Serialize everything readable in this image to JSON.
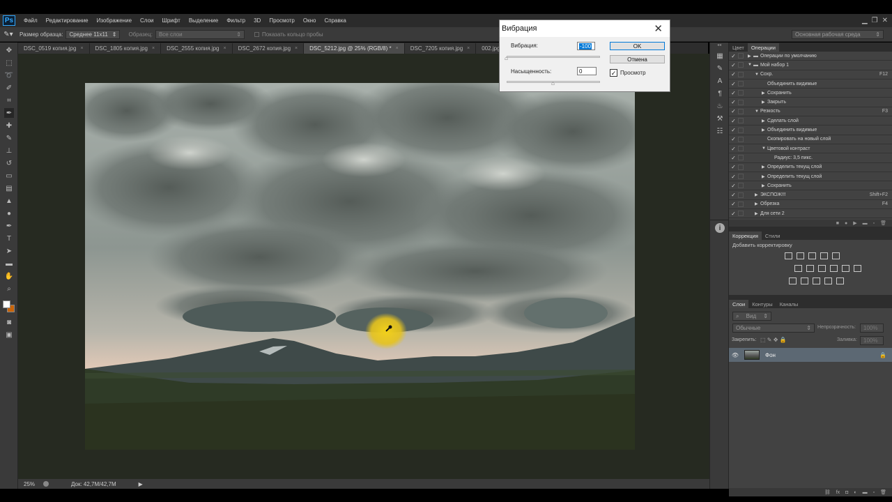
{
  "menu": [
    "Файл",
    "Редактирование",
    "Изображение",
    "Слои",
    "Шрифт",
    "Выделение",
    "Фильтр",
    "3D",
    "Просмотр",
    "Окно",
    "Справка"
  ],
  "app_logo": "Ps",
  "options": {
    "sample_size_label": "Размер образца:",
    "sample_size_value": "Среднее 11x11",
    "sample_label": "Образец:",
    "sample_value": "Все слои",
    "show_ring": "Показать кольцо пробы",
    "workspace": "Основная рабочая среда"
  },
  "tabs": [
    "DSC_0519 копия.jpg",
    "DSC_1805 копия.jpg",
    "DSC_2555 копия.jpg",
    "DSC_2672 копия.jpg",
    "DSC_5212.jpg @ 25% (RGB/8) *",
    "DSC_7205 копия.jpg",
    "002.jpg"
  ],
  "status": {
    "zoom": "25%",
    "doc": "Док: 42,7M/42,7M"
  },
  "dialog": {
    "title": "Вибрация",
    "vibrance_label": "Вибрация:",
    "vibrance_value": "-100",
    "saturation_label": "Насыщенность:",
    "saturation_value": "0",
    "ok": "OK",
    "cancel": "Отмена",
    "preview": "Просмотр",
    "vibrance_level": 0.0,
    "saturation_level": 0.5
  },
  "actions_panel": {
    "tabs": [
      "Цвет",
      "Операции"
    ],
    "rows": [
      {
        "label": "Операции по умолчанию",
        "shortcut": ""
      },
      {
        "label": "Мой набор 1",
        "shortcut": ""
      },
      {
        "label": "Сохр.",
        "shortcut": "F12"
      },
      {
        "label": "Объединить видимые",
        "shortcut": ""
      },
      {
        "label": "Сохранить",
        "shortcut": ""
      },
      {
        "label": "Закрыть",
        "shortcut": ""
      },
      {
        "label": "Резкость",
        "shortcut": "F3"
      },
      {
        "label": "Сделать слой",
        "shortcut": ""
      },
      {
        "label": "Объединить видимые",
        "shortcut": ""
      },
      {
        "label": "Скопировать на новый слой",
        "shortcut": ""
      },
      {
        "label": "Цветовой контраст",
        "shortcut": ""
      },
      {
        "label": "Радиус: 3,5 пикс.",
        "shortcut": ""
      },
      {
        "label": "Определить текущ слой",
        "shortcut": ""
      },
      {
        "label": "Определить текущ слой",
        "shortcut": ""
      },
      {
        "label": "Сохранить",
        "shortcut": ""
      },
      {
        "label": "ЭКСПОЖ!!!",
        "shortcut": "Shift+F2"
      },
      {
        "label": "Обрезка",
        "shortcut": "F4"
      },
      {
        "label": "Для сети 2",
        "shortcut": ""
      }
    ]
  },
  "adjust_panel": {
    "tabs": [
      "Коррекция",
      "Стили"
    ],
    "hint": "Добавить корректировку"
  },
  "layers_panel": {
    "tabs": [
      "Слои",
      "Контуры",
      "Каналы"
    ],
    "filter": "Вид",
    "blend": "Обычные",
    "opacity_label": "Непрозрачность:",
    "opacity_value": "100%",
    "lock_label": "Закрепить:",
    "fill_label": "Заливка:",
    "fill_value": "100%",
    "layer_name": "Фон"
  },
  "colors": {
    "accent": "#0078d7",
    "panel": "#3c3c3c",
    "canvas_bg": "#262a21"
  }
}
